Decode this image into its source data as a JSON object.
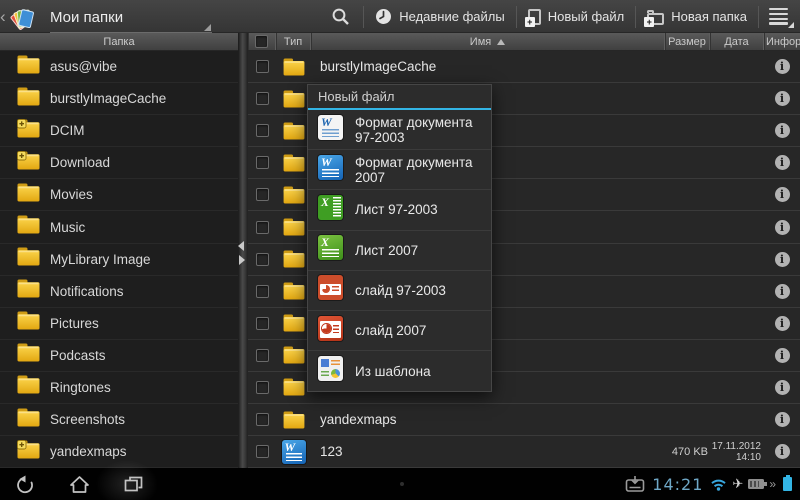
{
  "actionBar": {
    "title": "Мои папки",
    "buttons": {
      "recent": "Недавние файлы",
      "newFile": "Новый файл",
      "newFolder": "Новая папка"
    }
  },
  "sidebar": {
    "header": "Папка",
    "folders": [
      {
        "name": "asus@vibe",
        "badge": false
      },
      {
        "name": "burstlyImageCache",
        "badge": false
      },
      {
        "name": "DCIM",
        "badge": true
      },
      {
        "name": "Download",
        "badge": true
      },
      {
        "name": "Movies",
        "badge": false
      },
      {
        "name": "Music",
        "badge": false
      },
      {
        "name": "MyLibrary Image",
        "badge": false
      },
      {
        "name": "Notifications",
        "badge": false
      },
      {
        "name": "Pictures",
        "badge": false
      },
      {
        "name": "Podcasts",
        "badge": false
      },
      {
        "name": "Ringtones",
        "badge": false
      },
      {
        "name": "Screenshots",
        "badge": false
      },
      {
        "name": "yandexmaps",
        "badge": true
      }
    ]
  },
  "table": {
    "headers": {
      "type": "Тип",
      "name": "Имя",
      "size": "Размер",
      "date": "Дата",
      "info": "Инфор"
    },
    "sort": {
      "column": "Имя",
      "direction": "asc"
    },
    "rows": [
      {
        "name": "burstlyImageCache",
        "type": "folder",
        "size": "",
        "date": "",
        "time": ""
      },
      {
        "name": "",
        "type": "folder",
        "size": "",
        "date": "",
        "time": ""
      },
      {
        "name": "",
        "type": "folder",
        "size": "",
        "date": "",
        "time": ""
      },
      {
        "name": "",
        "type": "folder",
        "size": "",
        "date": "",
        "time": ""
      },
      {
        "name": "",
        "type": "folder",
        "size": "",
        "date": "",
        "time": ""
      },
      {
        "name": "",
        "type": "folder",
        "size": "",
        "date": "",
        "time": ""
      },
      {
        "name": "",
        "type": "folder",
        "size": "",
        "date": "",
        "time": ""
      },
      {
        "name": "",
        "type": "folder",
        "size": "",
        "date": "",
        "time": ""
      },
      {
        "name": "",
        "type": "folder",
        "size": "",
        "date": "",
        "time": ""
      },
      {
        "name": "",
        "type": "folder",
        "size": "",
        "date": "",
        "time": ""
      },
      {
        "name": "",
        "type": "folder",
        "size": "",
        "date": "",
        "time": ""
      },
      {
        "name": "yandexmaps",
        "type": "folder",
        "size": "",
        "date": "",
        "time": ""
      },
      {
        "name": "123",
        "type": "word2007",
        "size": "470 KB",
        "date": "17.11.2012",
        "time": "14:10"
      }
    ]
  },
  "popup": {
    "title": "Новый файл",
    "items": [
      {
        "label": "Формат документа 97-2003",
        "icon": "word97"
      },
      {
        "label": "Формат документа 2007",
        "icon": "word2007"
      },
      {
        "label": "Лист 97-2003",
        "icon": "excel97"
      },
      {
        "label": "Лист 2007",
        "icon": "excel2007"
      },
      {
        "label": "слайд 97-2003",
        "icon": "ppt97"
      },
      {
        "label": "слайд 2007",
        "icon": "ppt2007"
      },
      {
        "label": "Из шаблона",
        "icon": "template"
      }
    ]
  },
  "systemBar": {
    "time": "14:21"
  },
  "colors": {
    "accent": "#33b5e5",
    "folderYellow": "#f3c62b",
    "timeText": "#6fa8c7"
  }
}
